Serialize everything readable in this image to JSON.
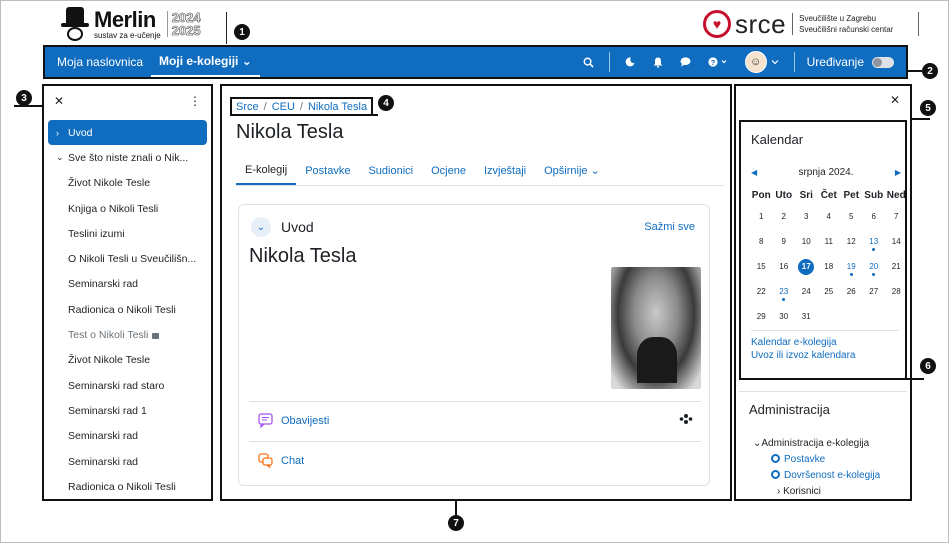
{
  "brand": {
    "name": "Merlin",
    "tagline": "sustav za e-učenje",
    "year_top": "2024",
    "year_bottom": "2025",
    "partner_word": "srce",
    "partner_line1": "Sveučilište u Zagrebu",
    "partner_line2": "Sveučilišni računski centar"
  },
  "navbar": {
    "items": [
      {
        "label": "Moja naslovnica"
      },
      {
        "label": "Moji e-kolegiji ⌄"
      }
    ],
    "edit_label": "Uređivanje"
  },
  "callouts": [
    "1",
    "2",
    "3",
    "4",
    "5",
    "6",
    "7"
  ],
  "course_index": {
    "items": [
      {
        "label": "Uvod"
      },
      {
        "label": "Sve što niste znali o Nik..."
      },
      {
        "label": "Život Nikole Tesle"
      },
      {
        "label": "Knjiga o Nikoli Tesli"
      },
      {
        "label": "Teslini izumi"
      },
      {
        "label": "O Nikoli Tesli u Sveučilišn..."
      },
      {
        "label": "Seminarski rad"
      },
      {
        "label": "Radionica o Nikoli Tesli"
      },
      {
        "label": "Test o Nikoli Tesli"
      },
      {
        "label": "Život Nikole Tesle"
      },
      {
        "label": "Seminarski rad staro"
      },
      {
        "label": "Seminarski rad 1"
      },
      {
        "label": "Seminarski rad"
      },
      {
        "label": "Seminarski rad"
      },
      {
        "label": "Radionica o Nikoli Tesli"
      }
    ]
  },
  "breadcrumb": [
    "Srce",
    "CEU",
    "Nikola Tesla"
  ],
  "page": {
    "title": "Nikola Tesla",
    "tabs": [
      "E-kolegij",
      "Postavke",
      "Sudionici",
      "Ocjene",
      "Izvještaji",
      "Opširnije ⌄"
    ]
  },
  "section": {
    "title": "Uvod",
    "collapse_label": "Sažmi sve",
    "heading": "Nikola Tesla",
    "activities": [
      {
        "label": "Obavijesti"
      },
      {
        "label": "Chat"
      }
    ]
  },
  "calendar": {
    "title": "Kalendar",
    "month": "srpnja 2024.",
    "weekdays": [
      "Pon",
      "Uto",
      "Sri",
      "Čet",
      "Pet",
      "Sub",
      "Ned"
    ],
    "weeks": [
      [
        "1",
        "2",
        "3",
        "4",
        "5",
        "6",
        "7"
      ],
      [
        "8",
        "9",
        "10",
        "11",
        "12",
        "13",
        "14"
      ],
      [
        "15",
        "16",
        "17",
        "18",
        "19",
        "20",
        "21"
      ],
      [
        "22",
        "23",
        "24",
        "25",
        "26",
        "27",
        "28"
      ],
      [
        "29",
        "30",
        "31",
        "",
        "",
        "",
        ""
      ]
    ],
    "today": "17",
    "event_days": [
      "13",
      "19",
      "20",
      "23"
    ],
    "links": [
      "Kalendar e-kolegija",
      "Uvoz ili izvoz kalendara"
    ]
  },
  "administration": {
    "title": "Administracija",
    "root": "Administracija e-kolegija",
    "items": [
      "Postavke",
      "Dovršenost e-kolegija"
    ],
    "users": "Korisnici"
  },
  "colors": {
    "primary": "#0f6cbf",
    "brand_red": "#c8102e"
  }
}
